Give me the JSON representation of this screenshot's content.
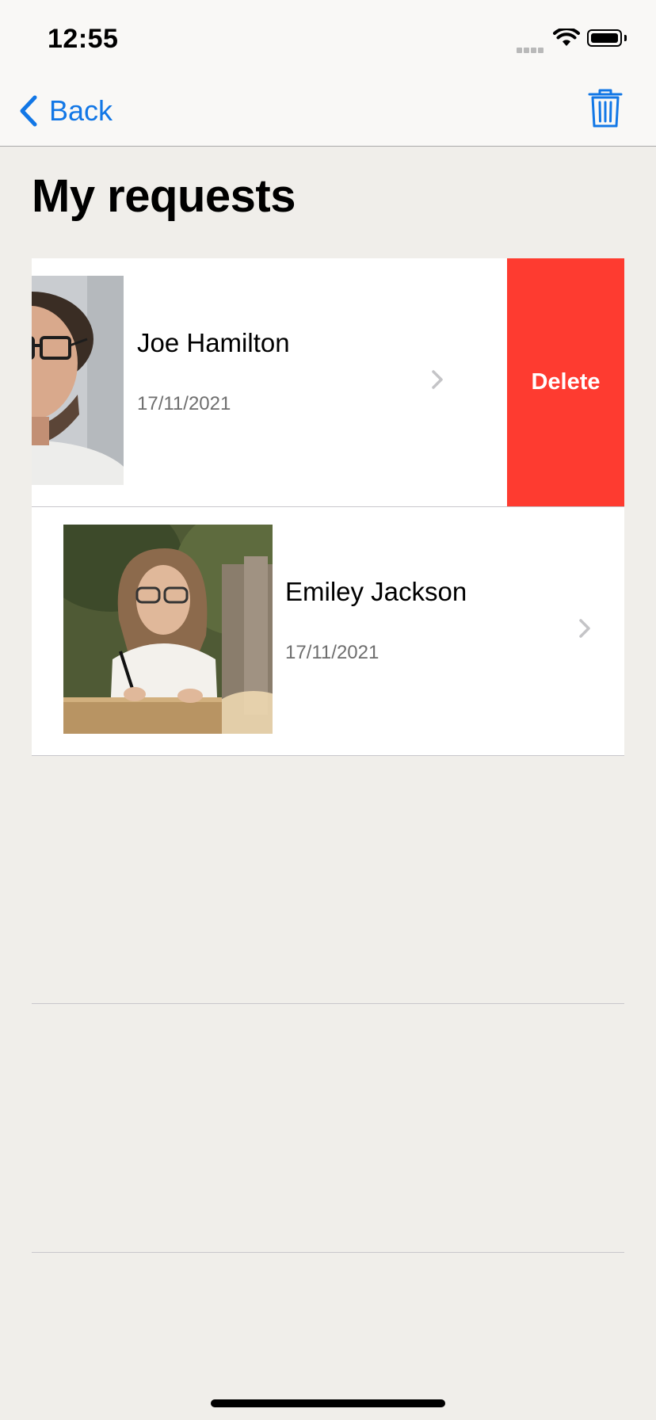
{
  "status_bar": {
    "time": "12:55",
    "icons": [
      "cellular-signal-icon",
      "wifi-icon",
      "battery-icon"
    ]
  },
  "nav_bar": {
    "back_label": "Back",
    "back_icon": "chevron-left-icon",
    "trash_icon": "trash-icon",
    "accent_color": "#1277e6"
  },
  "page": {
    "title": "My requests"
  },
  "requests": [
    {
      "name": "Joe Hamilton",
      "date": "17/11/2021",
      "avatar": "man-with-glasses-photo",
      "swiped": true
    },
    {
      "name": "Emiley Jackson",
      "date": "17/11/2021",
      "avatar": "woman-writing-photo",
      "swiped": false
    }
  ],
  "row_actions": {
    "delete_label": "Delete",
    "delete_color": "#fe3b30"
  }
}
